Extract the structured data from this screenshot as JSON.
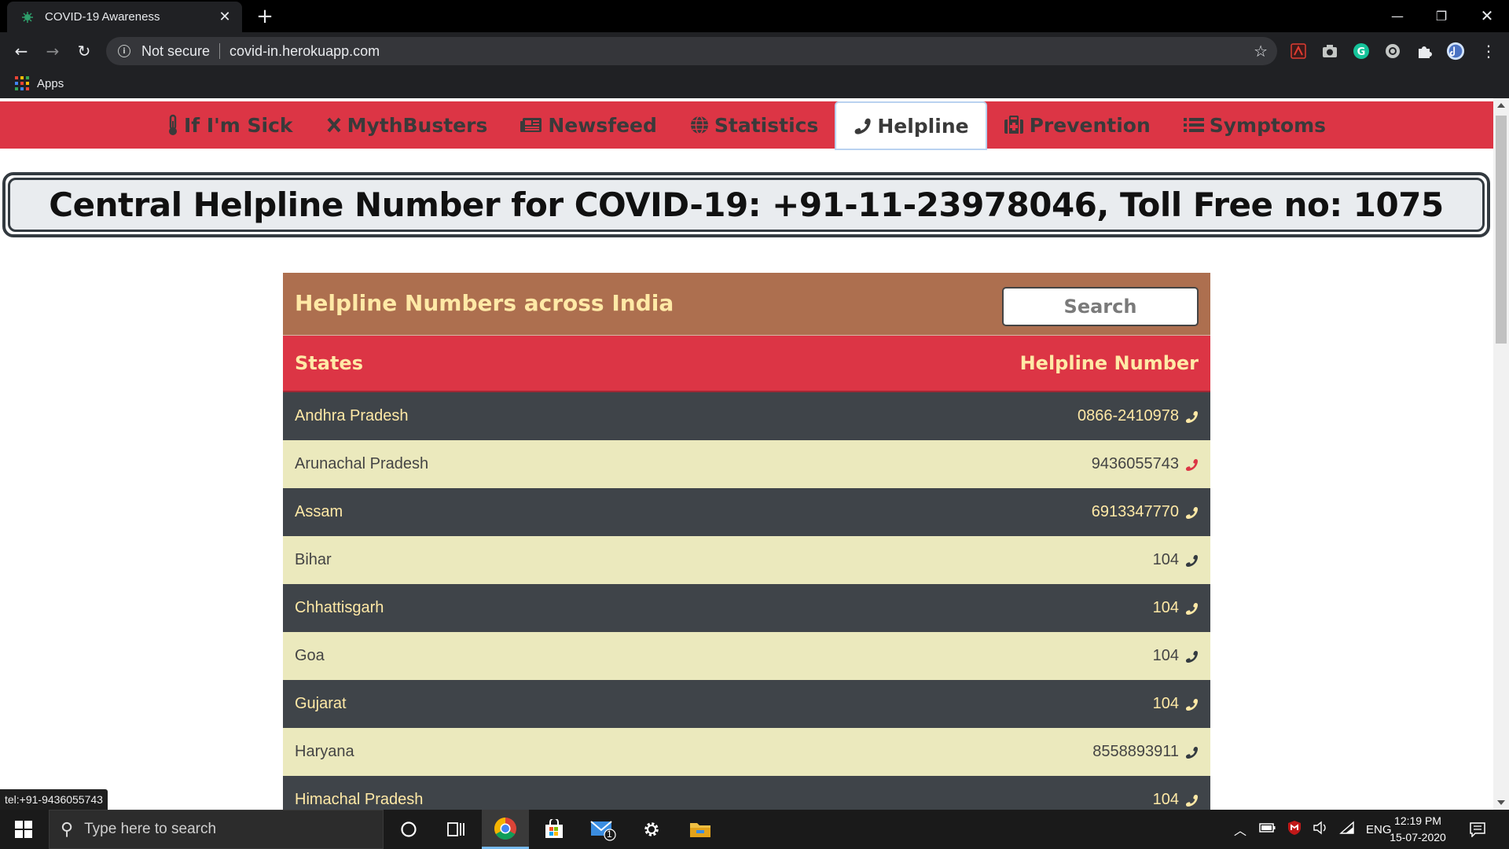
{
  "browser": {
    "tab_title": "COVID-19 Awareness",
    "security_label": "Not secure",
    "url": "covid-in.herokuapp.com",
    "bookmarks_apps_label": "Apps"
  },
  "site_nav": {
    "items": [
      {
        "label": "If I'm Sick",
        "icon": "thermometer-icon",
        "active": false
      },
      {
        "label": "MythBusters",
        "icon": "times-icon",
        "active": false
      },
      {
        "label": "Newsfeed",
        "icon": "newspaper-icon",
        "active": false
      },
      {
        "label": "Statistics",
        "icon": "globe-icon",
        "active": false
      },
      {
        "label": "Helpline",
        "icon": "phone-icon",
        "active": true
      },
      {
        "label": "Prevention",
        "icon": "medkit-icon",
        "active": false
      },
      {
        "label": "Symptoms",
        "icon": "list-icon",
        "active": false
      }
    ]
  },
  "banner": {
    "text": "Central Helpline Number for COVID-19: +91-11-23978046, Toll Free no: 1075"
  },
  "helpline_card": {
    "title": "Helpline Numbers across India",
    "search_placeholder": "Search",
    "col_states": "States",
    "col_number": "Helpline Number",
    "rows": [
      {
        "state": "Andhra Pradesh",
        "number": "0866-2410978"
      },
      {
        "state": "Arunachal Pradesh",
        "number": "9436055743"
      },
      {
        "state": "Assam",
        "number": "6913347770"
      },
      {
        "state": "Bihar",
        "number": "104"
      },
      {
        "state": "Chhattisgarh",
        "number": "104"
      },
      {
        "state": "Goa",
        "number": "104"
      },
      {
        "state": "Gujarat",
        "number": "104"
      },
      {
        "state": "Haryana",
        "number": "8558893911"
      },
      {
        "state": "Himachal Pradesh",
        "number": "104"
      }
    ]
  },
  "status_link": "tel:+91-9436055743",
  "taskbar": {
    "search_placeholder": "Type here to search",
    "language": "ENG",
    "time": "12:19 PM",
    "date": "15-07-2020",
    "mail_badge": "1"
  },
  "colors": {
    "nav_red": "#dc3545",
    "card_header_brown": "#ad6f4f",
    "accent_cream": "#ffe9a6",
    "row_dark": "#3f4449",
    "row_light": "#ebe9bd",
    "phone_hover_red": "#dc3545"
  }
}
